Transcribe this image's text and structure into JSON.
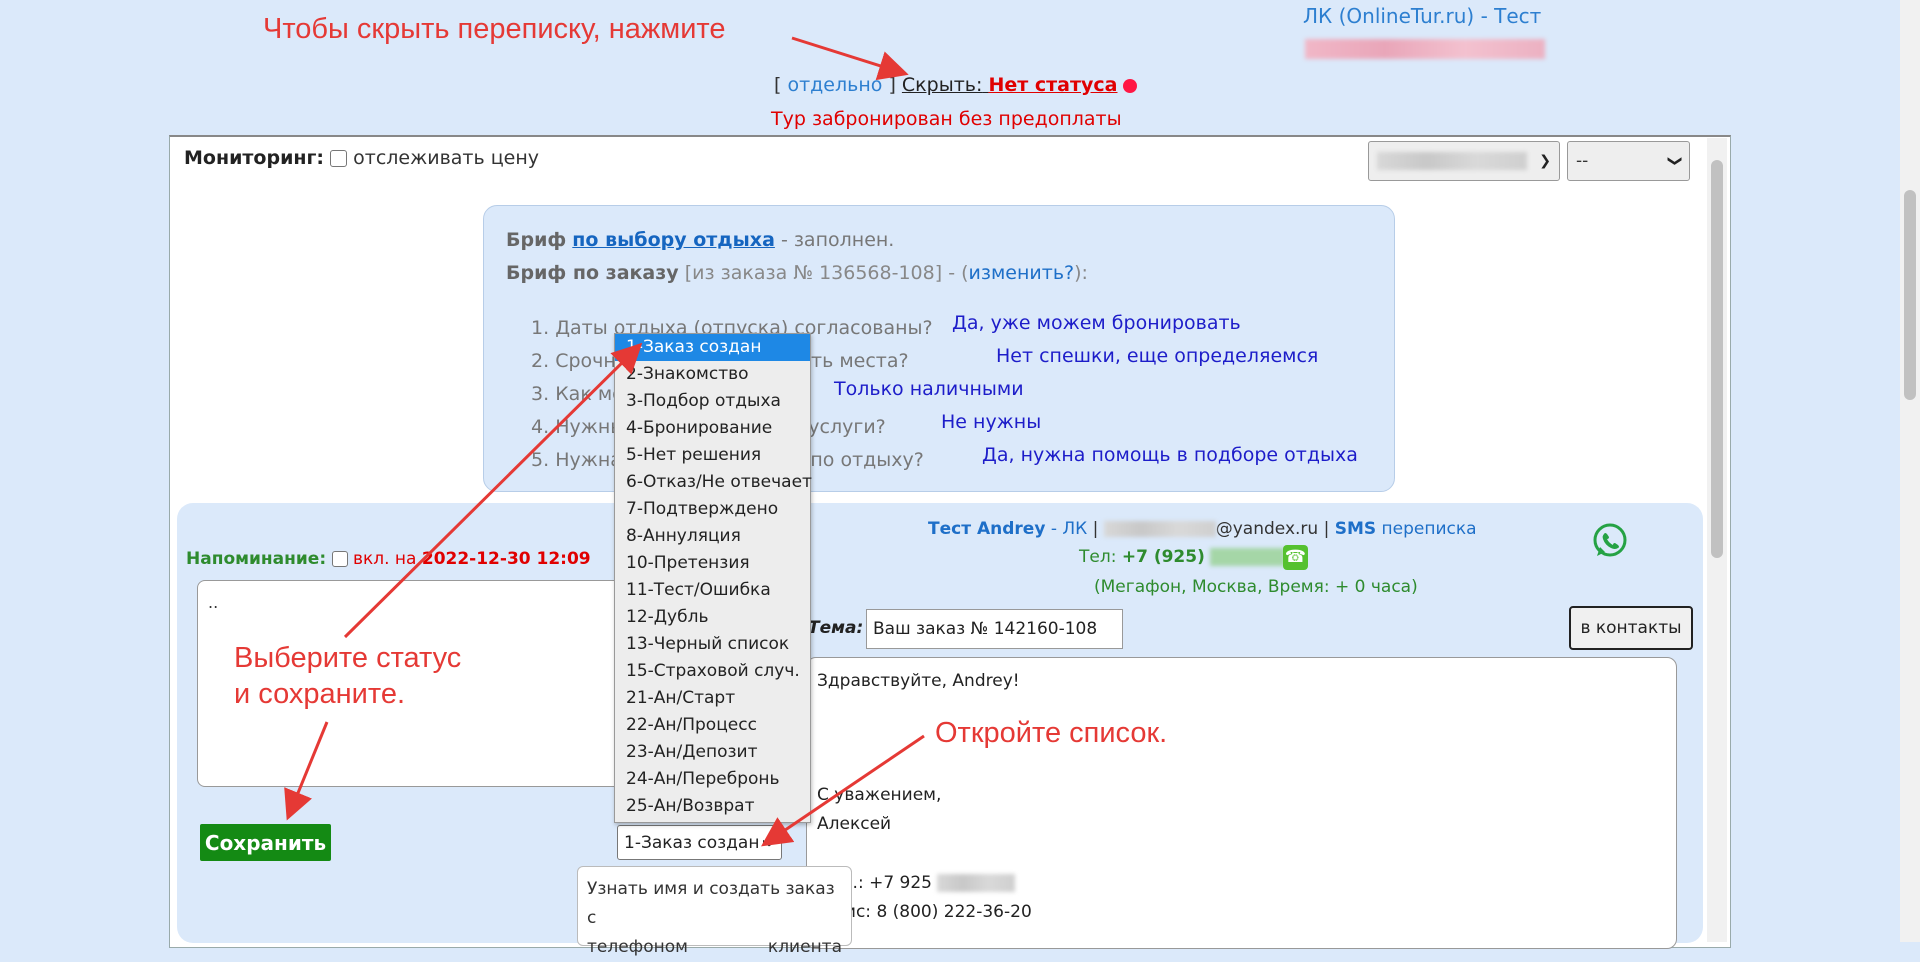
{
  "header": {
    "account_link": "ЛК (OnlineTur.ru) - Тест",
    "bracket_open": "[",
    "separate_link": "отдельно",
    "bracket_close": "]",
    "hide_label": "Скрыть:",
    "status_label": "Нет статуса",
    "status_note": "Тур забронирован без предоплаты"
  },
  "annotations": {
    "hide": "Чтобы скрыть переписку, нажмите",
    "choose_line1": "Выберите статус",
    "choose_line2": "и сохраните.",
    "open_list": "Откройте список."
  },
  "monitoring": {
    "label": "Мониторинг:",
    "checkbox_label": "отслеживать цену",
    "select2_value": "--"
  },
  "brief": {
    "label1": "Бриф",
    "link1": "по выбору отдыха",
    "status1": "- заполнен.",
    "label2": "Бриф по заказу",
    "order_ref": "[из заказа № 136568-108]",
    "dash": "- (",
    "edit_link": "изменить?",
    "close": "):",
    "questions": [
      {
        "num": "1.",
        "text": "Даты отдыха (отпуска) согласованы?",
        "answer": "Да, уже можем бронировать"
      },
      {
        "num": "2.",
        "text": "Срочно нужно бронировать места?",
        "answer": "Нет спешки, еще определяемся"
      },
      {
        "num": "3.",
        "text": "Как можно оплатить?",
        "answer": "Только наличными"
      },
      {
        "num": "4.",
        "text": "Нужны дополнительные услуги?",
        "answer": "Не нужны"
      },
      {
        "num": "5.",
        "text": "Нужна помощь эксперта по отдыху?",
        "answer": "Да, нужна помощь в подборе отдыха"
      }
    ]
  },
  "reminder": {
    "label": "Напоминание:",
    "on_label": "вкл. на",
    "datetime": "2022-12-30 12:09",
    "memo_text": ".."
  },
  "save_button": "Сохранить",
  "status_dropdown": {
    "items": [
      "1-Заказ создан",
      "2-Знакомство",
      "3-Подбор отдыха",
      "4-Бронирование",
      "5-Нет решения",
      "6-Отказ/Не отвечает",
      "7-Подтверждено",
      "8-Аннуляция",
      "10-Претензия",
      "11-Тест/Ошибка",
      "12-Дубль",
      "13-Черный список",
      "15-Страховой случ.",
      "21-Ан/Старт",
      "22-Ан/Процесс",
      "23-Ан/Депозит",
      "24-Ан/Перебронь",
      "25-Ан/Возврат"
    ],
    "selected_index": 0,
    "current_value": "1-Заказ создан"
  },
  "tooltip": {
    "line1": "Узнать имя и создать заказ с",
    "line2_left": "телефоном",
    "line2_right": "клиента"
  },
  "contact": {
    "name": "Тест Andrey",
    "lk_link": "- ЛК",
    "sep": "|",
    "email_domain": "@yandex.ru",
    "sms_label": "SMS",
    "chat_link": "переписка",
    "phone_label": "Тел:",
    "phone_prefix": "+7 (925)",
    "operator_info": "(Мегафон, Москва, Время: + 0 часа)"
  },
  "subject": {
    "label": "Тема:",
    "value": "Ваш заказ № 142160-108"
  },
  "contacts_button": "в контакты",
  "message": {
    "greeting": "Здравствуйте, Andrey!",
    "regards": "С уважением,",
    "signature": "Алексей",
    "mobile": "Моб.: +7 925",
    "office": "Офис: 8 (800) 222-36-20"
  },
  "colors": {
    "page_bg": "#dbe9fa",
    "annotation_red": "#e53935",
    "link_blue": "#1e6fc8",
    "save_green": "#148a14",
    "dropdown_highlight": "#1e88e5",
    "whatsapp_green": "#25a244"
  }
}
